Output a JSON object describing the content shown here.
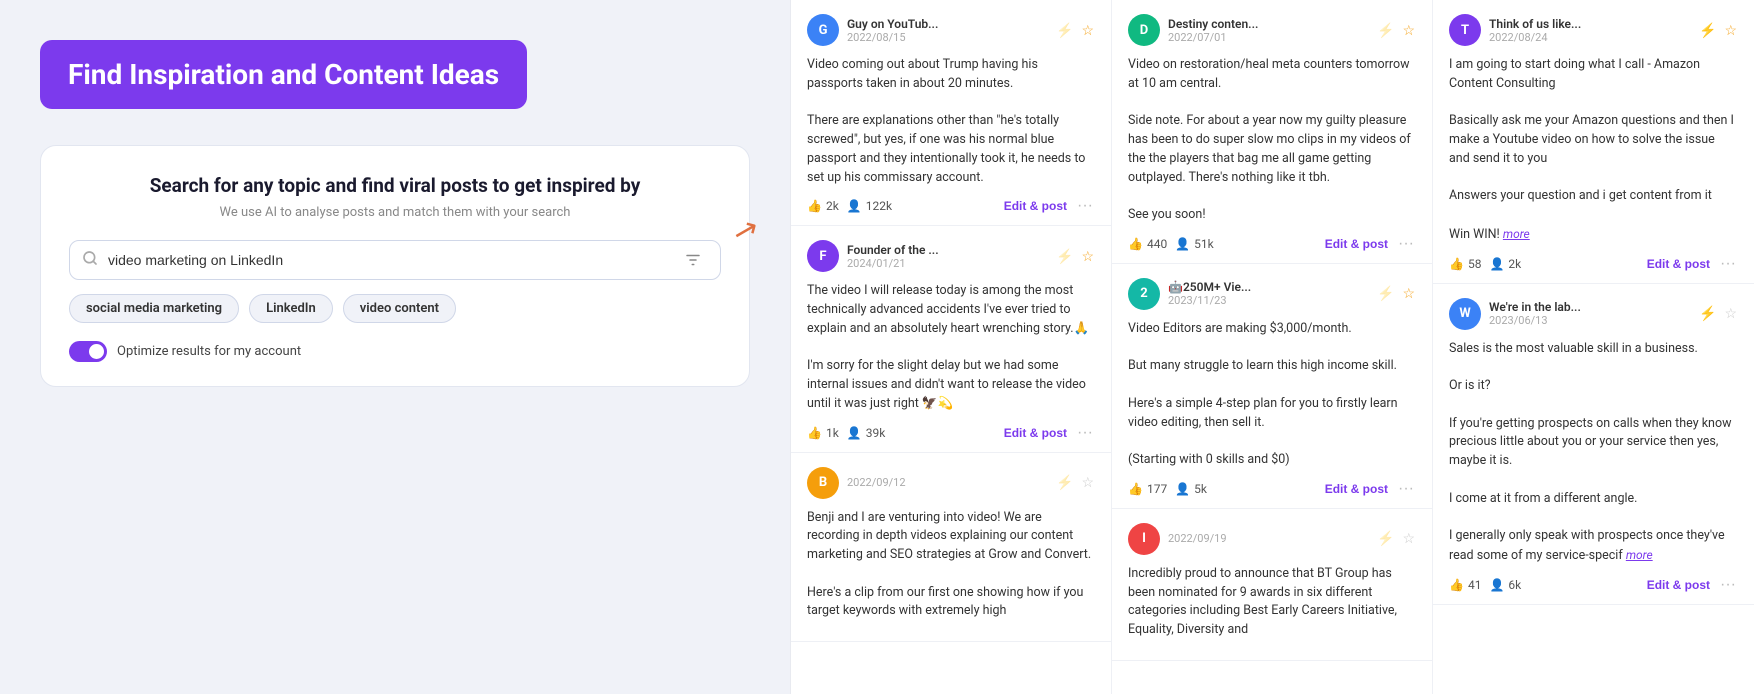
{
  "hero": {
    "badge_text": "Find Inspiration and Content Ideas"
  },
  "search_box": {
    "title": "Search for any topic and find viral posts to get inspired by",
    "subtitle": "We use AI to analyse posts and match them with your search",
    "input_value": "video marketing on LinkedIn",
    "input_placeholder": "video marketing on LinkedIn",
    "tags": [
      "social media marketing",
      "LinkedIn",
      "video content"
    ],
    "optimize_label": "Optimize results for my account"
  },
  "columns": [
    {
      "cards": [
        {
          "author": "Guy on YouTub...",
          "date": "2022/08/15",
          "avatar_initials": "G",
          "avatar_color": "blue",
          "body": "Video coming out about Trump having his passports taken in about 20 minutes.\n\nThere are explanations other than \"he's totally screwed\", but yes, if one was his normal blue passport and they intentionally took it, he needs to set up his commissary account.",
          "likes": "2k",
          "comments": "122k",
          "has_lightning": false,
          "has_star": true
        },
        {
          "author": "Founder of the ...",
          "date": "2024/01/21",
          "avatar_initials": "F",
          "avatar_color": "purple",
          "body": "The video I will release today is among the most technically advanced accidents I've ever tried to explain and an absolutely heart wrenching story.🙏\n\nI'm sorry for the slight delay but we had some internal issues and didn't want to release the video until it was just right 🦅💫",
          "likes": "1k",
          "comments": "39k",
          "has_lightning": false,
          "has_star": true
        },
        {
          "author": "",
          "date": "2022/09/12",
          "avatar_initials": "B",
          "avatar_color": "orange",
          "body": "Benji and I are venturing into video! We are recording in depth videos explaining our content marketing and SEO strategies at Grow and Convert.\n\nHere's a clip from our first one showing how if you target keywords with extremely high",
          "likes": null,
          "comments": null,
          "has_lightning": false,
          "has_star": false,
          "no_footer": true
        }
      ]
    },
    {
      "cards": [
        {
          "author": "Destiny conten...",
          "date": "2022/07/01",
          "avatar_initials": "D",
          "avatar_color": "green",
          "body": "Video on restoration/heal meta counters tomorrow at 10 am central.\n\nSide note. For about a year now my guilty pleasure has been to do super slow mo clips in my videos of the the players that bag me all game getting outplayed. There's nothing like it tbh.\n\nSee you soon!",
          "likes": "440",
          "comments": "51k",
          "has_lightning": false,
          "has_star": true
        },
        {
          "author": "🤖250M+ Vie...",
          "date": "2023/11/23",
          "avatar_initials": "2",
          "avatar_color": "teal",
          "body": "Video Editors are making $3,000/month.\n\nBut many struggle to learn this high income skill.\n\nHere's a simple 4-step plan for you to firstly learn video editing, then sell it.\n\n(Starting with 0 skills and $0)",
          "likes": "177",
          "comments": "5k",
          "has_lightning": false,
          "has_star": true
        },
        {
          "author": "",
          "date": "2022/09/19",
          "avatar_initials": "I",
          "avatar_color": "red",
          "body": "Incredibly proud to announce that BT Group has been nominated for 9 awards in six different categories including Best Early Careers Initiative, Equality, Diversity and",
          "likes": null,
          "comments": null,
          "has_lightning": false,
          "has_star": false,
          "no_footer": true
        }
      ]
    },
    {
      "cards": [
        {
          "author": "Think of us like...",
          "date": "2022/08/24",
          "avatar_initials": "T",
          "avatar_color": "purple",
          "body": "I am going to start doing what I call - Amazon Content Consulting\n\nBasically ask me your Amazon questions and then I make a Youtube video on how to solve the issue and send it to you\n\nAnswers your question and i get content from it\n\nWin WIN!",
          "likes": "58",
          "comments": "2k",
          "has_lightning": true,
          "has_star": true,
          "more": true
        },
        {
          "author": "We're in the lab...",
          "date": "2023/06/13",
          "avatar_initials": "W",
          "avatar_color": "blue",
          "body": "Sales is the most valuable skill in a business.\n\nOr is it?\n\nIf you're getting prospects on calls when they know precious little about you or your service then yes, maybe it is.\n\nI come at it from a different angle.\n\nI generally only speak with prospects once they've read some of my service-specif",
          "likes": "41",
          "comments": "6k",
          "has_lightning": true,
          "has_star": false,
          "more": true
        }
      ]
    }
  ],
  "labels": {
    "edit_post": "Edit & post",
    "more": "more"
  }
}
